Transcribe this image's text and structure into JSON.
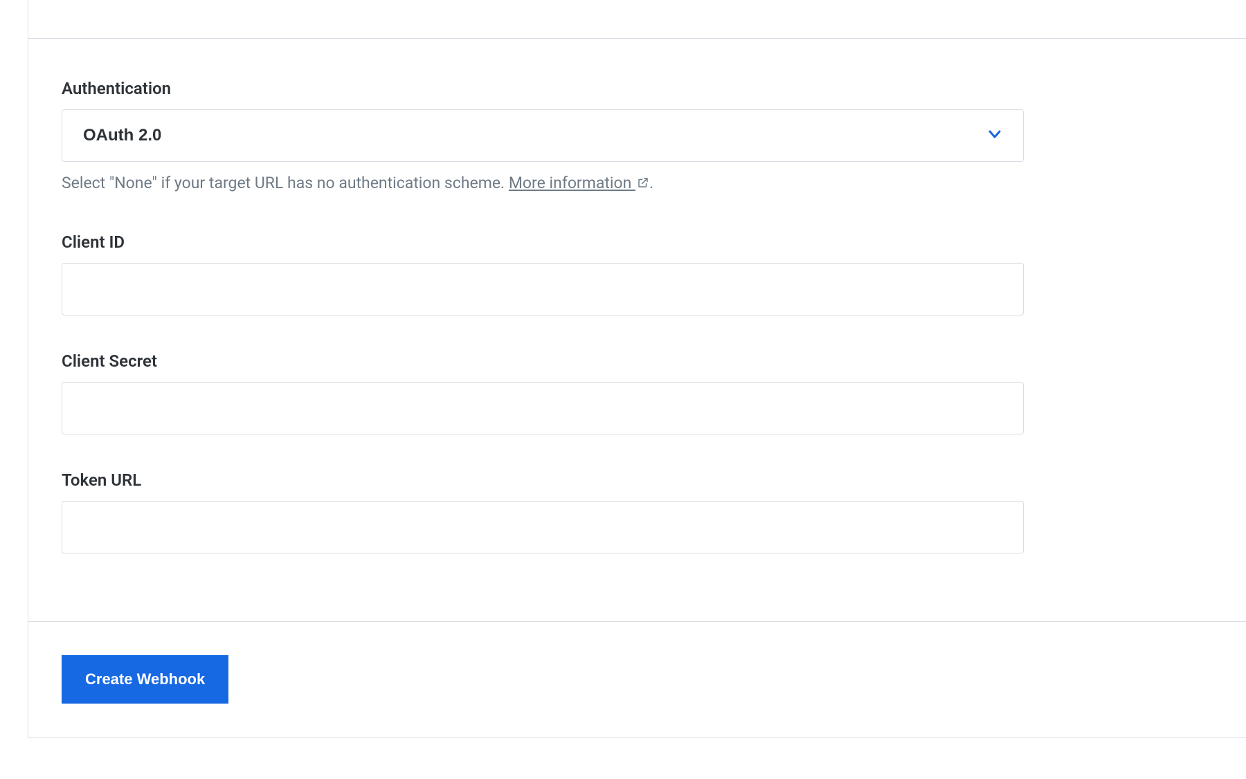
{
  "form": {
    "authentication": {
      "label": "Authentication",
      "selected": "OAuth 2.0",
      "help_prefix": "Select \"None\" if your target URL has no authentication scheme. ",
      "help_link": "More information ",
      "help_suffix": "."
    },
    "client_id": {
      "label": "Client ID",
      "value": ""
    },
    "client_secret": {
      "label": "Client Secret",
      "value": ""
    },
    "token_url": {
      "label": "Token URL",
      "value": ""
    }
  },
  "footer": {
    "create_label": "Create Webhook"
  },
  "colors": {
    "primary": "#1668e3",
    "border": "#d8dde4",
    "text": "#2e3338",
    "muted": "#6e7a86"
  }
}
